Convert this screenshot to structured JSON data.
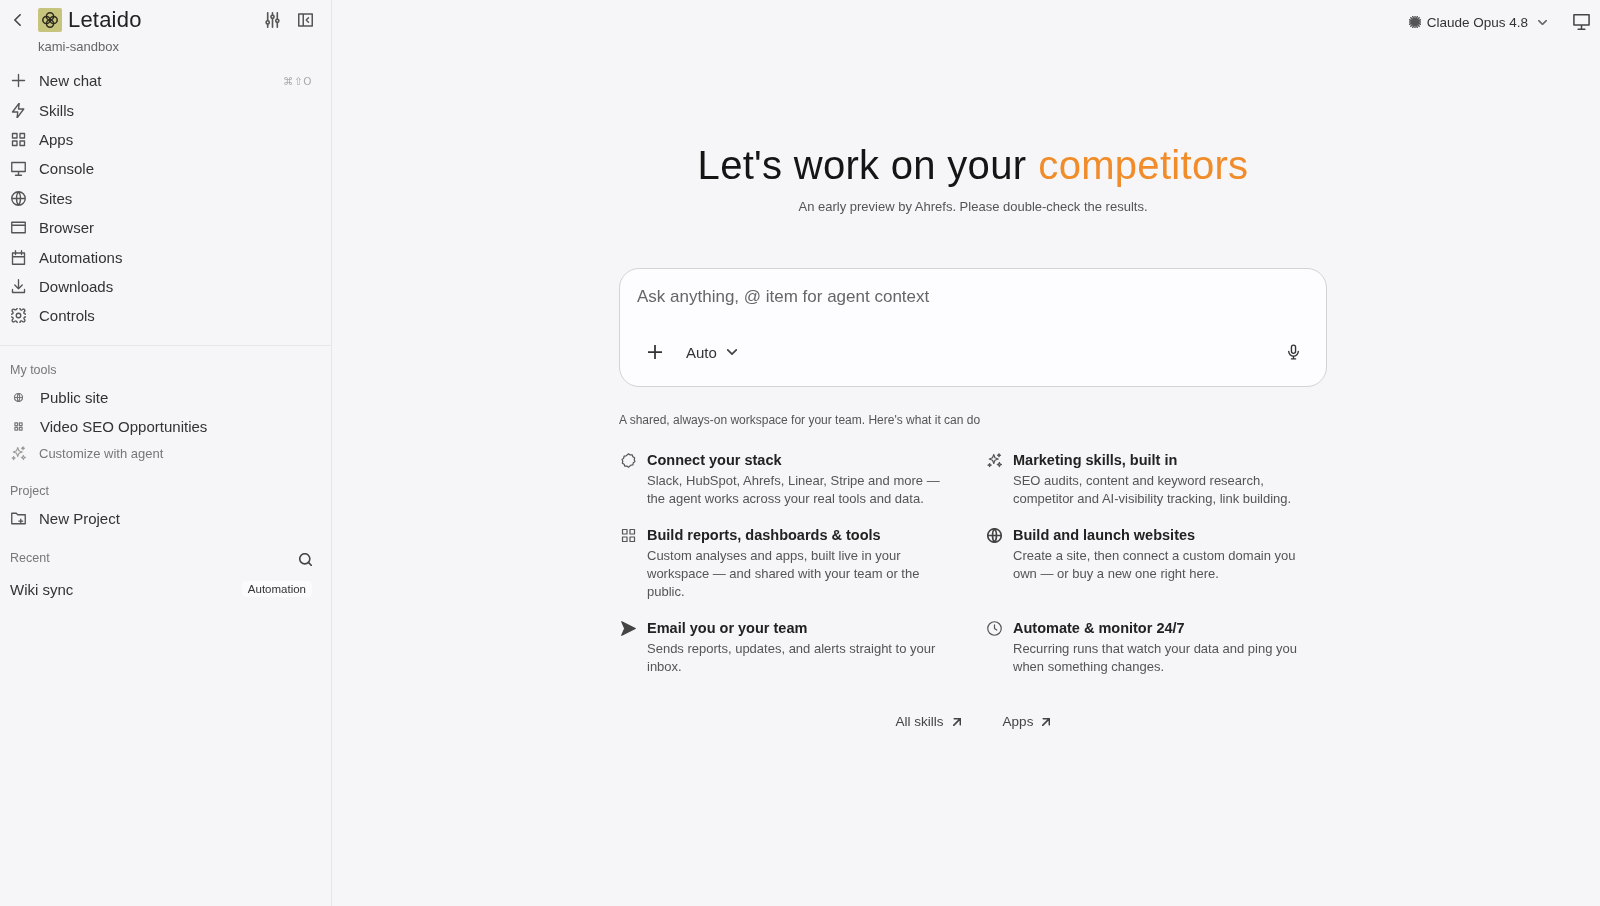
{
  "sidebar": {
    "brand": "Letaido",
    "workspace": "kami-sandbox",
    "nav": [
      {
        "label": "New chat",
        "shortcut": "⌘⇧O"
      },
      {
        "label": "Skills"
      },
      {
        "label": "Apps"
      },
      {
        "label": "Console"
      },
      {
        "label": "Sites"
      },
      {
        "label": "Browser"
      },
      {
        "label": "Automations"
      },
      {
        "label": "Downloads"
      },
      {
        "label": "Controls"
      }
    ],
    "my_tools": {
      "label": "My tools",
      "items": [
        {
          "label": "Public site",
          "kind": "tool"
        },
        {
          "label": "Video SEO Opportunities",
          "kind": "tool"
        },
        {
          "label": "Customize with agent",
          "kind": "action"
        }
      ]
    },
    "project": {
      "label": "Project",
      "items": [
        {
          "label": "New Project"
        }
      ]
    },
    "recent": {
      "label": "Recent",
      "items": [
        {
          "title": "Wiki sync",
          "badge": "Automation"
        }
      ]
    }
  },
  "header": {
    "model": "Claude Opus 4.8"
  },
  "hero": {
    "title": "Let's work on your",
    "highlight": "competitors",
    "subtitle": "An early preview by Ahrefs. Please double-check the results."
  },
  "composer": {
    "placeholder": "Ask anything, @ item for agent context",
    "mode": "Auto"
  },
  "features": {
    "intro": "A shared, always-on workspace for your team. Here's what it can do",
    "items": [
      {
        "title": "Connect your stack",
        "description": "Slack, HubSpot, Ahrefs, Linear, Stripe and more — the agent works across your real tools and data."
      },
      {
        "title": "Marketing skills, built in",
        "description": "SEO audits, content and keyword research, competitor and AI-visibility tracking, link building."
      },
      {
        "title": "Build reports, dashboards & tools",
        "description": "Custom analyses and apps, built live in your workspace — and shared with your team or the public."
      },
      {
        "title": "Build and launch websites",
        "description": "Create a site, then connect a custom domain you own — or buy a new one right here."
      },
      {
        "title": "Email you or your team",
        "description": "Sends reports, updates, and alerts straight to your inbox."
      },
      {
        "title": "Automate & monitor 24/7",
        "description": "Recurring runs that watch your data and ping you when something changes."
      }
    ]
  },
  "links": [
    {
      "label": "All skills"
    },
    {
      "label": "Apps"
    }
  ]
}
